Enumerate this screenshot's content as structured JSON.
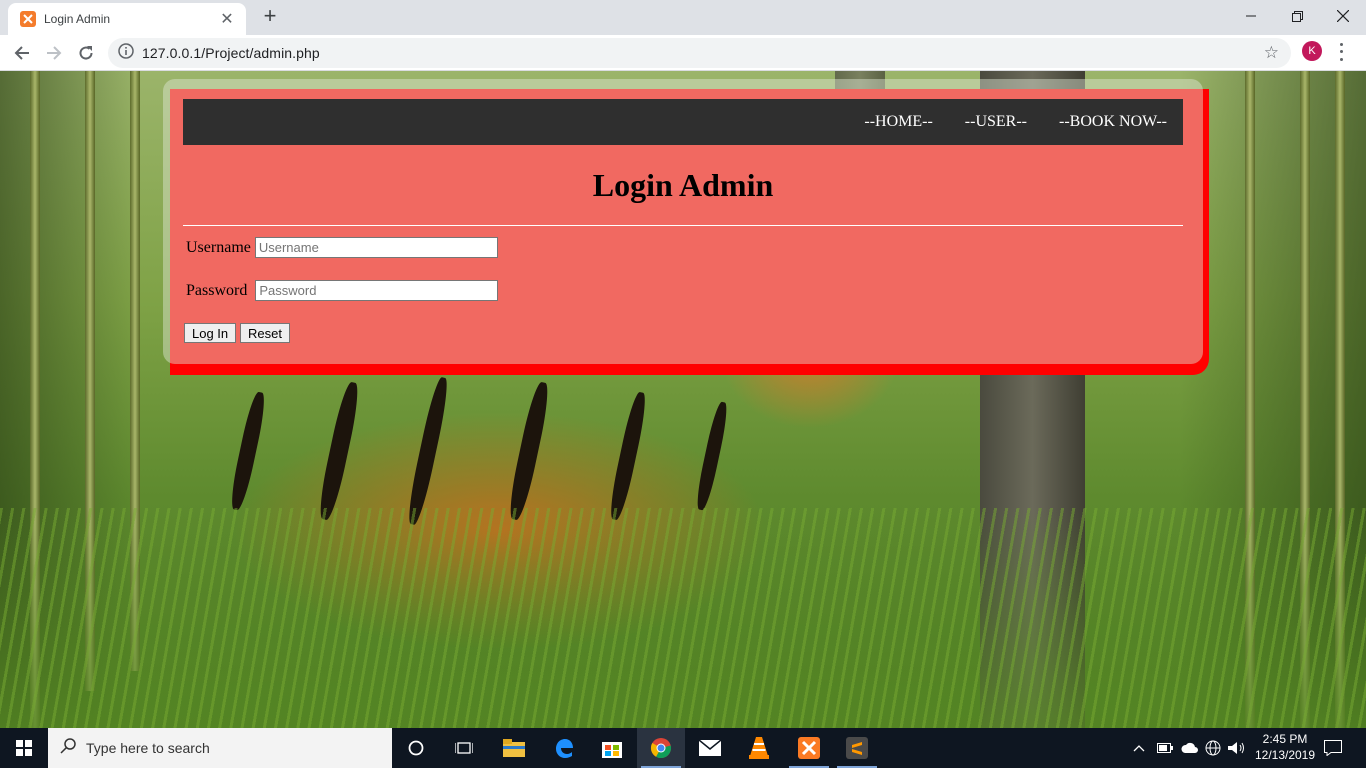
{
  "browser": {
    "tab_title": "Login Admin",
    "url": "127.0.0.1/Project/admin.php",
    "profile_initial": "K"
  },
  "nav": {
    "items": [
      "--HOME--",
      "--USER--",
      "--BOOK NOW--"
    ]
  },
  "login": {
    "title": "Login Admin",
    "username_label": "Username",
    "username_placeholder": "Username",
    "password_label": "Password",
    "password_placeholder": "Password",
    "login_button": "Log In",
    "reset_button": "Reset"
  },
  "taskbar": {
    "search_placeholder": "Type here to search",
    "time": "2:45 PM",
    "date": "12/13/2019"
  },
  "colors": {
    "panel_border": "#ff0000",
    "nav_bg": "#2f2f2f",
    "profile": "#c2185b"
  }
}
